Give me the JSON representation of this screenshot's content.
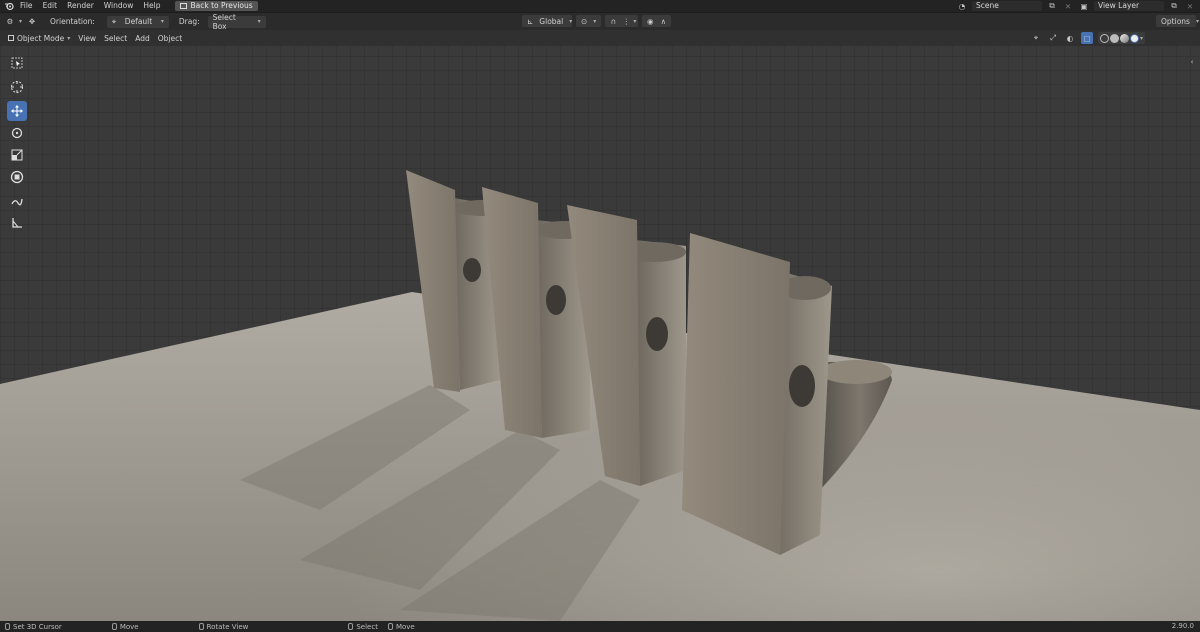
{
  "topbar": {
    "menu": [
      "File",
      "Edit",
      "Render",
      "Window",
      "Help"
    ],
    "back_button": "Back to Previous",
    "scene": "Scene",
    "view_layer": "View Layer"
  },
  "header": {
    "orientation_label": "Orientation:",
    "orientation_value": "Default",
    "drag_label": "Drag:",
    "drag_value": "Select Box",
    "transform_orientation": "Global",
    "options_label": "Options"
  },
  "viewport_header": {
    "mode": "Object Mode",
    "menus": [
      "View",
      "Select",
      "Add",
      "Object"
    ]
  },
  "statusbar": {
    "items": [
      "Set 3D Cursor",
      "Move",
      "Rotate View",
      "Select",
      "Move"
    ],
    "version": "2.90.0"
  },
  "colors": {
    "accent": "#4772b3",
    "background": "#1d1d1d",
    "floor": "#9a958d",
    "object": "#8b8478"
  },
  "icons": [
    "blender-logo-icon",
    "cursor-icon",
    "move-icon",
    "rotate-icon",
    "scale-icon",
    "transform-icon",
    "annotate-icon",
    "measure-icon"
  ]
}
